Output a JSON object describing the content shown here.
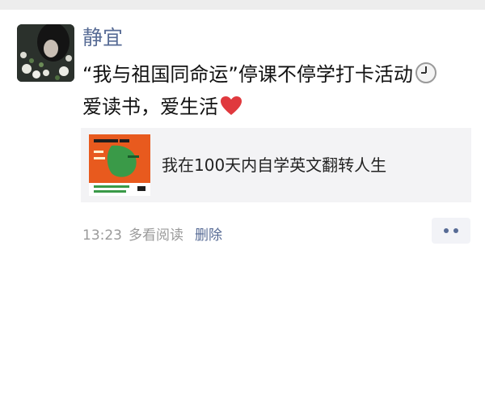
{
  "post": {
    "author": "静宜",
    "text_line1": "“我与祖国同命运”停课不停学打卡活动",
    "text_line2": "爱读书，爱生活",
    "emojis": [
      "clock-icon",
      "red-heart-icon"
    ]
  },
  "link_card": {
    "title": "我在100天内自学英文翻转人生"
  },
  "meta": {
    "time": "13:23",
    "source": "多看阅读",
    "delete_label": "删除"
  },
  "colors": {
    "name_blue": "#576b95",
    "card_bg": "#f3f3f5",
    "book_orange": "#e85a1e",
    "book_green": "#3a9a48"
  }
}
